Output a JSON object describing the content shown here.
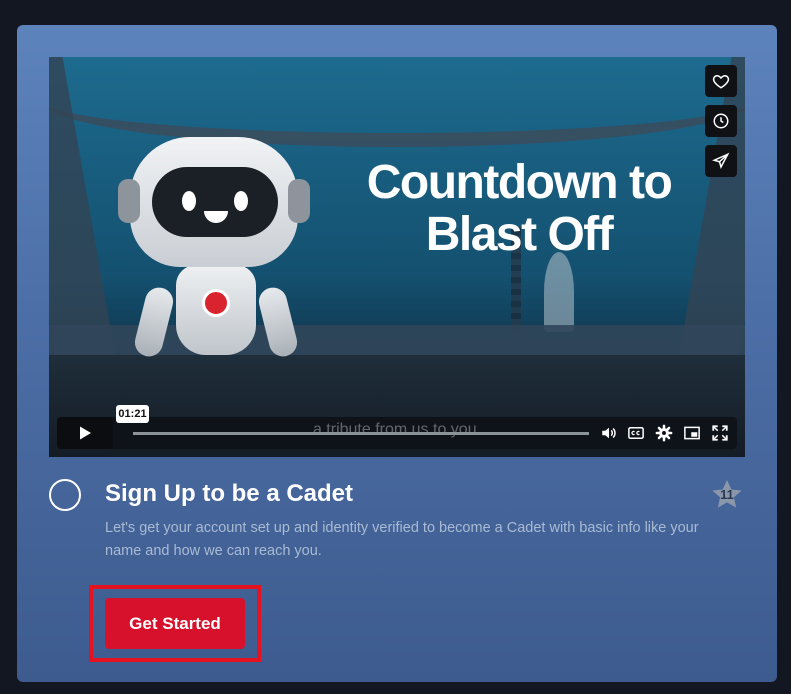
{
  "video": {
    "overlay_title": "Countdown to Blast Off",
    "subtitle": "a tribute from us to you.",
    "current_time": "01:21",
    "side_actions": [
      "heart-icon",
      "clock-icon",
      "send-icon"
    ],
    "control_icons": [
      "play-icon",
      "volume-icon",
      "captions-icon",
      "settings-icon",
      "pip-icon",
      "fullscreen-icon"
    ]
  },
  "lesson": {
    "title": "Sign Up to be a Cadet",
    "description": "Let's get your account set up and identity verified to become a Cadet with basic info like your name and how we can reach you.",
    "points": "11",
    "cta_label": "Get Started"
  },
  "colors": {
    "card_top": "#5d83bd",
    "card_bottom": "#3d5b8e",
    "cta": "#d7102c",
    "highlight": "#e5121f",
    "page_bg": "#131722"
  }
}
